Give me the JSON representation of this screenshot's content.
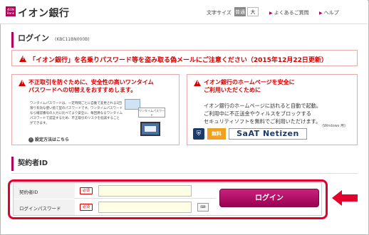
{
  "header": {
    "logo_mark": "ÆON Bank",
    "logo_text": "イオン銀行",
    "font_size_label": "文字サイズ",
    "font_size_normal": "普通",
    "font_size_large": "大",
    "faq_link": "よくあるご質問",
    "help_link": "ヘルプ"
  },
  "login_heading": {
    "title": "ログイン",
    "code": "(KBC11BN000B)"
  },
  "alert_banner": {
    "text": "「イオン銀行」を名乗りパスワード等を盗み取る偽メールにご注意ください（2015年12月22日更新）"
  },
  "notice_left": {
    "title_line1": "不正取引を防ぐために、安全性の高いワンタイム",
    "title_line2": "パスワードへの切替えをおすすめします。",
    "body": "ワンタイムパスワードは、一定時間ごとに自動で変更される1回限り有効な使い捨て型のパスワードです。ワンタイムパスワードなら確認番号の入力に比べてより安全に、毎回異なるワンタイムパスワードで認証するため、不正取引のリスクを低減することができます。",
    "card_label": "ワンタイムパスワード",
    "howto_link": "設定方法はこちら"
  },
  "notice_right": {
    "title_line1": "イオン銀行のホームページを安全に",
    "title_line2": "ご利用いただくために",
    "body_line1": "イオン銀行のホームページに訪れると自動で起動。",
    "body_line2": "ご利用中に不正送金やウィルスをブロックする",
    "body_line3": "セキュリティソフトを無料でご利用いただけます。",
    "windows_note": "(Windows 用)",
    "free_badge": "無料",
    "product_name": "SaAT Netizen"
  },
  "contract_heading": {
    "title": "契約者ID"
  },
  "form": {
    "id_label": "契約者ID",
    "password_label": "ログインパスワード",
    "required_badge": "必須",
    "id_value": "",
    "password_value": "",
    "keyboard_label": "⌨",
    "login_button": "ログイン"
  },
  "colors": {
    "brand": "#b0005a",
    "alert_red": "#d40000",
    "highlight_red": "#e3002d"
  }
}
